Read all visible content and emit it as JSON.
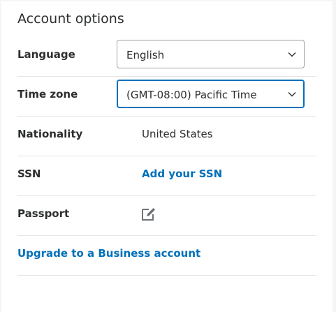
{
  "page": {
    "title": "Account options"
  },
  "language": {
    "label": "Language",
    "selected": "English"
  },
  "timezone": {
    "label": "Time zone",
    "selected": "(GMT-08:00) Pacific Time"
  },
  "nationality": {
    "label": "Nationality",
    "value": "United States"
  },
  "ssn": {
    "label": "SSN",
    "link": "Add your SSN"
  },
  "passport": {
    "label": "Passport",
    "icon": "edit-icon"
  },
  "upgrade": {
    "link": "Upgrade to a Business account"
  },
  "colors": {
    "link": "#0070ba",
    "text": "#2c2e2f",
    "divider": "#e5e5e5",
    "focus_border": "#0070ba"
  }
}
